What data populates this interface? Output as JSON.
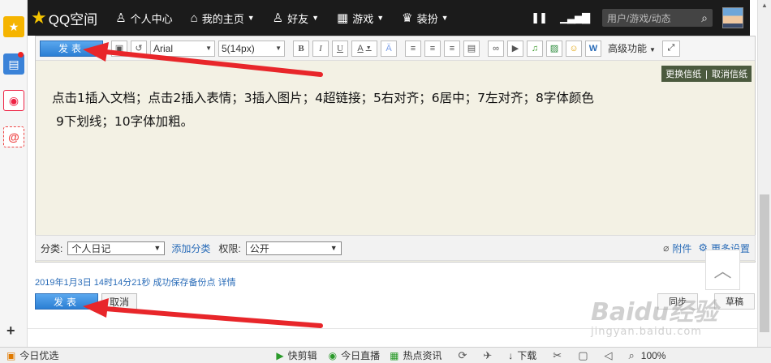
{
  "nav": {
    "logo_text": "QQ空间",
    "items": [
      {
        "label": "个人中心",
        "icon": "person-icon"
      },
      {
        "label": "我的主页",
        "icon": "home-icon",
        "caret": true
      },
      {
        "label": "好友",
        "icon": "friends-icon",
        "caret": true
      },
      {
        "label": "游戏",
        "icon": "grid-icon",
        "caret": true
      },
      {
        "label": "装扮",
        "icon": "shirt-icon",
        "caret": true
      }
    ],
    "search_placeholder": "用户/游戏/动态"
  },
  "toolbar": {
    "post_label": "发表",
    "font_family": "Arial",
    "font_size": "5(14px)",
    "bold": "B",
    "italic": "I",
    "underline": "U",
    "font_color": "A",
    "more_label": "高级功能"
  },
  "stationery": {
    "change": "更换信纸",
    "cancel": "取消信纸"
  },
  "content": {
    "line1": "点击1插入文档；点击2插入表情；3插入图片；4超链接；5右对齐；6居中；7左对齐；8字体颜色",
    "line2": "9下划线；10字体加粗。"
  },
  "category_row": {
    "category_label": "分类:",
    "category_value": "个人日记",
    "add_category": "添加分类",
    "permission_label": "权限:",
    "permission_value": "公开",
    "attachment": "附件",
    "more_settings": "更多设置"
  },
  "save_info": {
    "text": "2019年1月3日 14时14分21秒 成功保存备份点",
    "detail_link": "详情"
  },
  "actions": {
    "post_label": "发表",
    "cancel_label": "取消",
    "right_btn1": "同步",
    "right_btn2": "草稿"
  },
  "watermark": {
    "logo": "Baidu经验",
    "url": "jingyan.baidu.com"
  },
  "statusbar": {
    "today_pick": "今日优选",
    "quick_clip": "快剪辑",
    "today_live": "今日直播",
    "hot_news": "热点资讯",
    "download": "下载",
    "zoom": "100%"
  },
  "colors": {
    "nav_bg": "#1b1b1b",
    "editor_bg": "#f3f1e4",
    "post_button": "#2b7fd4",
    "link": "#2a6cb8",
    "arrow": "#e8262a"
  }
}
